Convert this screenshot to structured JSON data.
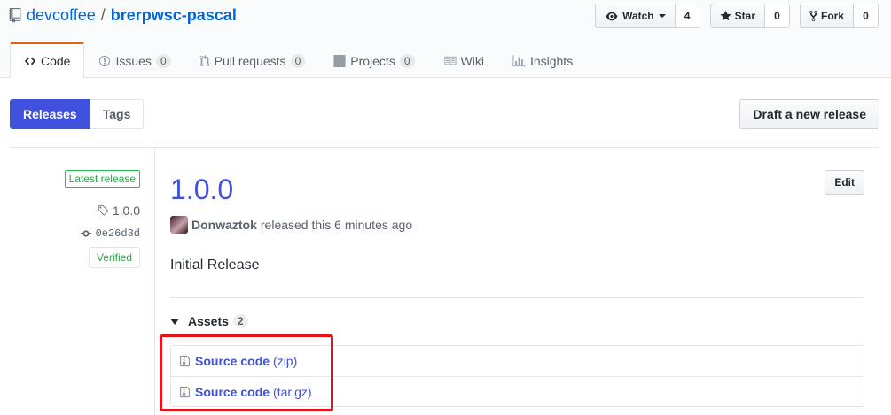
{
  "repo": {
    "owner": "devcoffee",
    "separator": "/",
    "name": "brerpwsc-pascal"
  },
  "actions": {
    "watch": {
      "label": "Watch",
      "count": "4"
    },
    "star": {
      "label": "Star",
      "count": "0"
    },
    "fork": {
      "label": "Fork",
      "count": "0"
    }
  },
  "nav": {
    "code": "Code",
    "issues": {
      "label": "Issues",
      "count": "0"
    },
    "pulls": {
      "label": "Pull requests",
      "count": "0"
    },
    "projects": {
      "label": "Projects",
      "count": "0"
    },
    "wiki": "Wiki",
    "insights": "Insights"
  },
  "subnav": {
    "releases": "Releases",
    "tags": "Tags",
    "draft": "Draft a new release"
  },
  "release": {
    "latest_label": "Latest release",
    "tag": "1.0.0",
    "commit": "0e26d3d",
    "verified": "Verified",
    "title": "1.0.0",
    "edit": "Edit",
    "author": "Donwaztok",
    "released_text": "released this 6 minutes ago",
    "description": "Initial Release",
    "assets_label": "Assets",
    "assets_count": "2",
    "assets": [
      {
        "name": "Source code",
        "ext": "(zip)"
      },
      {
        "name": "Source code",
        "ext": "(tar.gz)"
      }
    ]
  },
  "colors": {
    "accent": "#3f51dd",
    "highlight": "#e8111b",
    "tab_active": "#e36209",
    "verified": "#28a745"
  }
}
